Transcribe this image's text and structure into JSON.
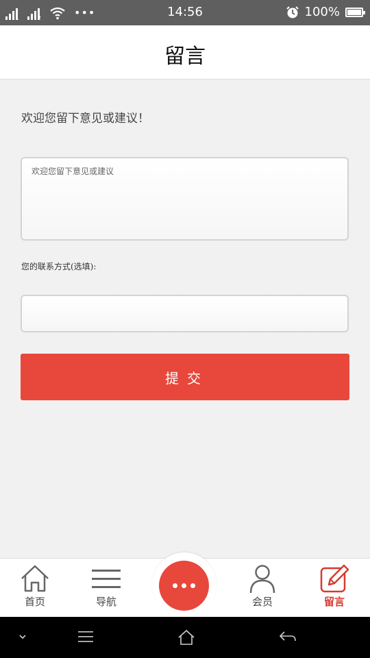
{
  "status_bar": {
    "time": "14:56",
    "battery": "100%",
    "sim1": "1",
    "sim2": "2",
    "more": "•••"
  },
  "header": {
    "title": "留言"
  },
  "form": {
    "welcome_text": "欢迎您留下意见或建议！",
    "message_placeholder": "欢迎您留下意见或建议",
    "contact_label": "您的联系方式(选填):",
    "contact_value": "",
    "submit_label": "提交"
  },
  "bottom_nav": {
    "items": [
      {
        "label": "首页",
        "icon": "home-icon"
      },
      {
        "label": "导航",
        "icon": "menu-icon"
      },
      {
        "label": "",
        "icon": "more-dots-icon"
      },
      {
        "label": "会员",
        "icon": "user-icon"
      },
      {
        "label": "留言",
        "icon": "edit-icon",
        "active": true
      }
    ]
  },
  "colors": {
    "accent": "#e8473b",
    "active_label": "#d63a30",
    "background": "#f1f1f1",
    "status_bar": "#5f5f5f"
  }
}
